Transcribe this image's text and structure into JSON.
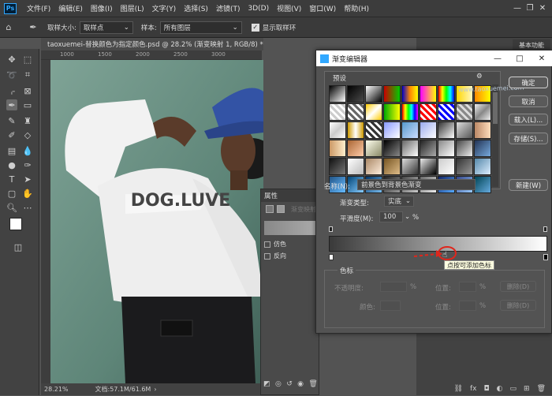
{
  "menubar": {
    "items": [
      "文件(F)",
      "编辑(E)",
      "图像(I)",
      "图层(L)",
      "文字(Y)",
      "选择(S)",
      "滤镜(T)",
      "3D(D)",
      "视图(V)",
      "窗口(W)",
      "帮助(H)"
    ],
    "logo": "Ps",
    "minimize": "—",
    "restore": "❐",
    "close": "✕"
  },
  "optionsbar": {
    "sample_size_label": "取样大小:",
    "sample_size_value": "取样点",
    "sample_label": "样本:",
    "sample_value": "所有图层",
    "show_ring_label": "显示取样环"
  },
  "document": {
    "tab_title": "taoxuemei-替换颜色为指定颜色.psd @ 28.2% (渐变映射 1, RGB/8) *",
    "tab_close": "✕",
    "ruler_ticks": [
      "1000",
      "1500",
      "2000",
      "2500",
      "3000"
    ],
    "zoom": "28.21%",
    "doc_size": "文档:57.1M/61.6M",
    "shirt_text": "DOG.LUVE"
  },
  "properties_panel": {
    "title": "属性",
    "adj_name": "渐变映射",
    "dither_label": "仿色",
    "reverse_label": "反向"
  },
  "right_panel": {
    "tab_label": "基本功能"
  },
  "gradient_dialog": {
    "title": "渐变编辑器",
    "presets_label": "预设",
    "ok": "确定",
    "cancel": "取消",
    "load": "载入(L)...",
    "save": "存储(S)...",
    "name_label": "名称(N):",
    "name_value": "前景色到背景色渐变",
    "new_button": "新建(W)",
    "type_label": "渐变类型:",
    "type_value": "实底",
    "smooth_label": "平滑度(M):",
    "smooth_value": "100",
    "percent": "%",
    "stops_label": "色标",
    "opacity_label": "不透明度:",
    "location_label": "位置:",
    "delete_label": "删除(D)",
    "color_label": "颜色:",
    "tooltip": "点按可添加色标",
    "watermark": "www.taoxuemei.com",
    "gear": "⚙"
  },
  "colors": {
    "accent_red": "#e0261c",
    "dialog_bg": "#535353",
    "ps_blue": "#31a8ff"
  }
}
